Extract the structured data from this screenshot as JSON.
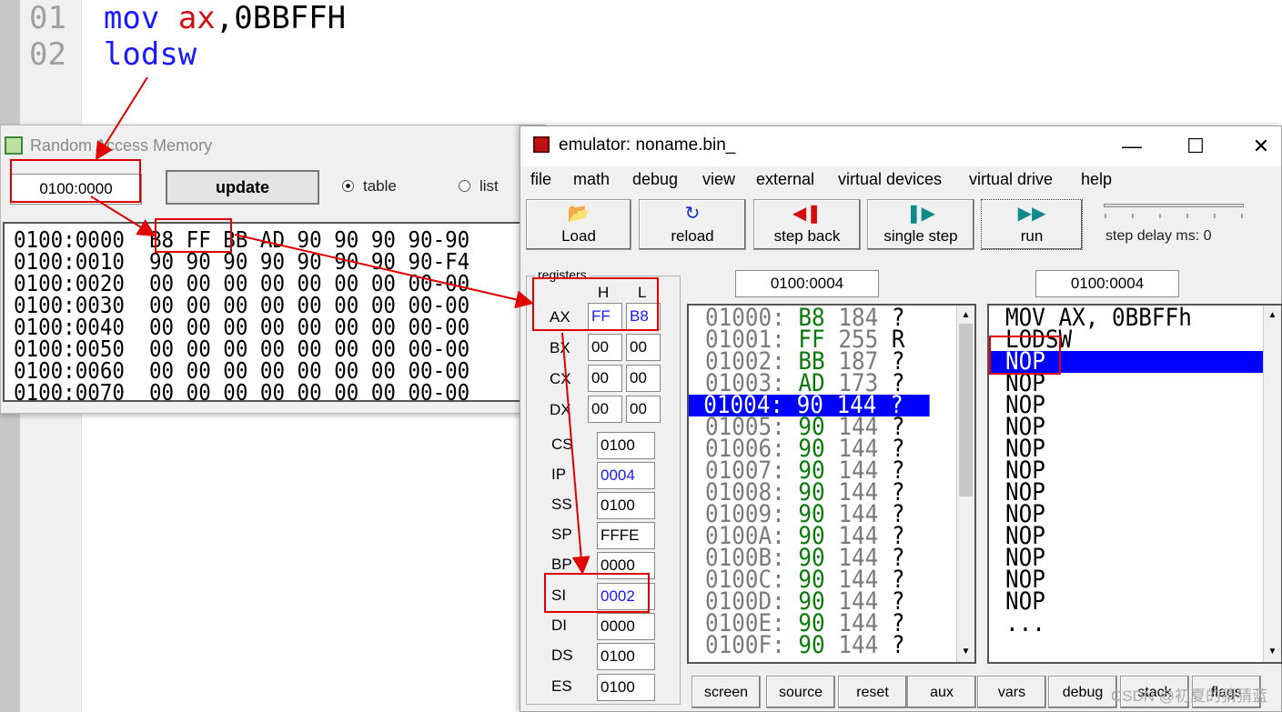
{
  "editor": {
    "lines": [
      {
        "num": "01",
        "keyword": "mov",
        "register": "ax",
        "separator": ",",
        "operand": "0BBFFH"
      },
      {
        "num": "02",
        "keyword": "lodsw"
      }
    ]
  },
  "ram_window": {
    "title": "Random Access Memory",
    "address": "0100:0000",
    "update_label": "update",
    "radio_table": "table",
    "radio_list": "list",
    "rows": [
      "0100:0000  B8 FF BB AD 90 90 90 90-90",
      "0100:0010  90 90 90 90 90 90 90 90-F4",
      "0100:0020  00 00 00 00 00 00 00 00-00",
      "0100:0030  00 00 00 00 00 00 00 00-00",
      "0100:0040  00 00 00 00 00 00 00 00-00",
      "0100:0050  00 00 00 00 00 00 00 00-00",
      "0100:0060  00 00 00 00 00 00 00 00-00",
      "0100:0070  00 00 00 00 00 00 00 00-00"
    ]
  },
  "emulator": {
    "title": "emulator: noname.bin_",
    "window_controls": {
      "minimize": "—",
      "maximize": "☐",
      "close": "✕"
    },
    "menu": [
      "file",
      "math",
      "debug",
      "view",
      "external",
      "virtual devices",
      "virtual drive",
      "help"
    ],
    "toolbar": [
      {
        "label": "Load",
        "icon": "folder-icon"
      },
      {
        "label": "reload",
        "icon": "reload-icon"
      },
      {
        "label": "step back",
        "icon": "step-back-icon"
      },
      {
        "label": "single step",
        "icon": "single-step-icon"
      },
      {
        "label": "run",
        "icon": "run-icon"
      }
    ],
    "step_delay_label": "step delay ms: 0",
    "registers_label": "registers",
    "reg_head_h": "H",
    "reg_head_l": "L",
    "registers_hl": [
      {
        "name": "AX",
        "h": "FF",
        "l": "B8",
        "changed": true
      },
      {
        "name": "BX",
        "h": "00",
        "l": "00",
        "changed": false
      },
      {
        "name": "CX",
        "h": "00",
        "l": "00",
        "changed": false
      },
      {
        "name": "DX",
        "h": "00",
        "l": "00",
        "changed": false
      }
    ],
    "registers_16": [
      {
        "name": "CS",
        "value": "0100",
        "changed": false
      },
      {
        "name": "IP",
        "value": "0004",
        "changed": true
      },
      {
        "name": "SS",
        "value": "0100",
        "changed": false
      },
      {
        "name": "SP",
        "value": "FFFE",
        "changed": false
      },
      {
        "name": "BP",
        "value": "0000",
        "changed": false
      },
      {
        "name": "SI",
        "value": "0002",
        "changed": true
      },
      {
        "name": "DI",
        "value": "0000",
        "changed": false
      },
      {
        "name": "DS",
        "value": "0100",
        "changed": false
      },
      {
        "name": "ES",
        "value": "0100",
        "changed": false
      }
    ],
    "mem_address": "0100:0004",
    "dis_address": "0100:0004",
    "memory": [
      {
        "addr": "01000:",
        "hex": "B8",
        "dec": "184",
        "chr": "?"
      },
      {
        "addr": "01001:",
        "hex": "FF",
        "dec": "255",
        "chr": "R"
      },
      {
        "addr": "01002:",
        "hex": "BB",
        "dec": "187",
        "chr": "?"
      },
      {
        "addr": "01003:",
        "hex": "AD",
        "dec": "173",
        "chr": "?"
      },
      {
        "addr": "01004:",
        "hex": "90",
        "dec": "144",
        "chr": "?"
      },
      {
        "addr": "01005:",
        "hex": "90",
        "dec": "144",
        "chr": "?"
      },
      {
        "addr": "01006:",
        "hex": "90",
        "dec": "144",
        "chr": "?"
      },
      {
        "addr": "01007:",
        "hex": "90",
        "dec": "144",
        "chr": "?"
      },
      {
        "addr": "01008:",
        "hex": "90",
        "dec": "144",
        "chr": "?"
      },
      {
        "addr": "01009:",
        "hex": "90",
        "dec": "144",
        "chr": "?"
      },
      {
        "addr": "0100A:",
        "hex": "90",
        "dec": "144",
        "chr": "?"
      },
      {
        "addr": "0100B:",
        "hex": "90",
        "dec": "144",
        "chr": "?"
      },
      {
        "addr": "0100C:",
        "hex": "90",
        "dec": "144",
        "chr": "?"
      },
      {
        "addr": "0100D:",
        "hex": "90",
        "dec": "144",
        "chr": "?"
      },
      {
        "addr": "0100E:",
        "hex": "90",
        "dec": "144",
        "chr": "?"
      },
      {
        "addr": "0100F:",
        "hex": "90",
        "dec": "144",
        "chr": "?"
      }
    ],
    "memory_selected_index": 4,
    "disassembly": [
      "MOV AX, 0BBFFh",
      "LODSW",
      "NOP",
      "NOP",
      "NOP",
      "NOP",
      "NOP",
      "NOP",
      "NOP",
      "NOP",
      "NOP",
      "NOP",
      "NOP",
      "NOP",
      "..."
    ],
    "disassembly_selected_index": 2,
    "bottom_buttons": [
      "screen",
      "source",
      "reset",
      "aux",
      "vars",
      "debug",
      "stack",
      "flags"
    ]
  },
  "watermark": "CSDN @初夏的猜猜蓝",
  "colors": {
    "highlight": "#0000ff",
    "annotation": "#e00000",
    "changed_register": "#1a1aff",
    "hex_green": "#0a7a0a"
  }
}
